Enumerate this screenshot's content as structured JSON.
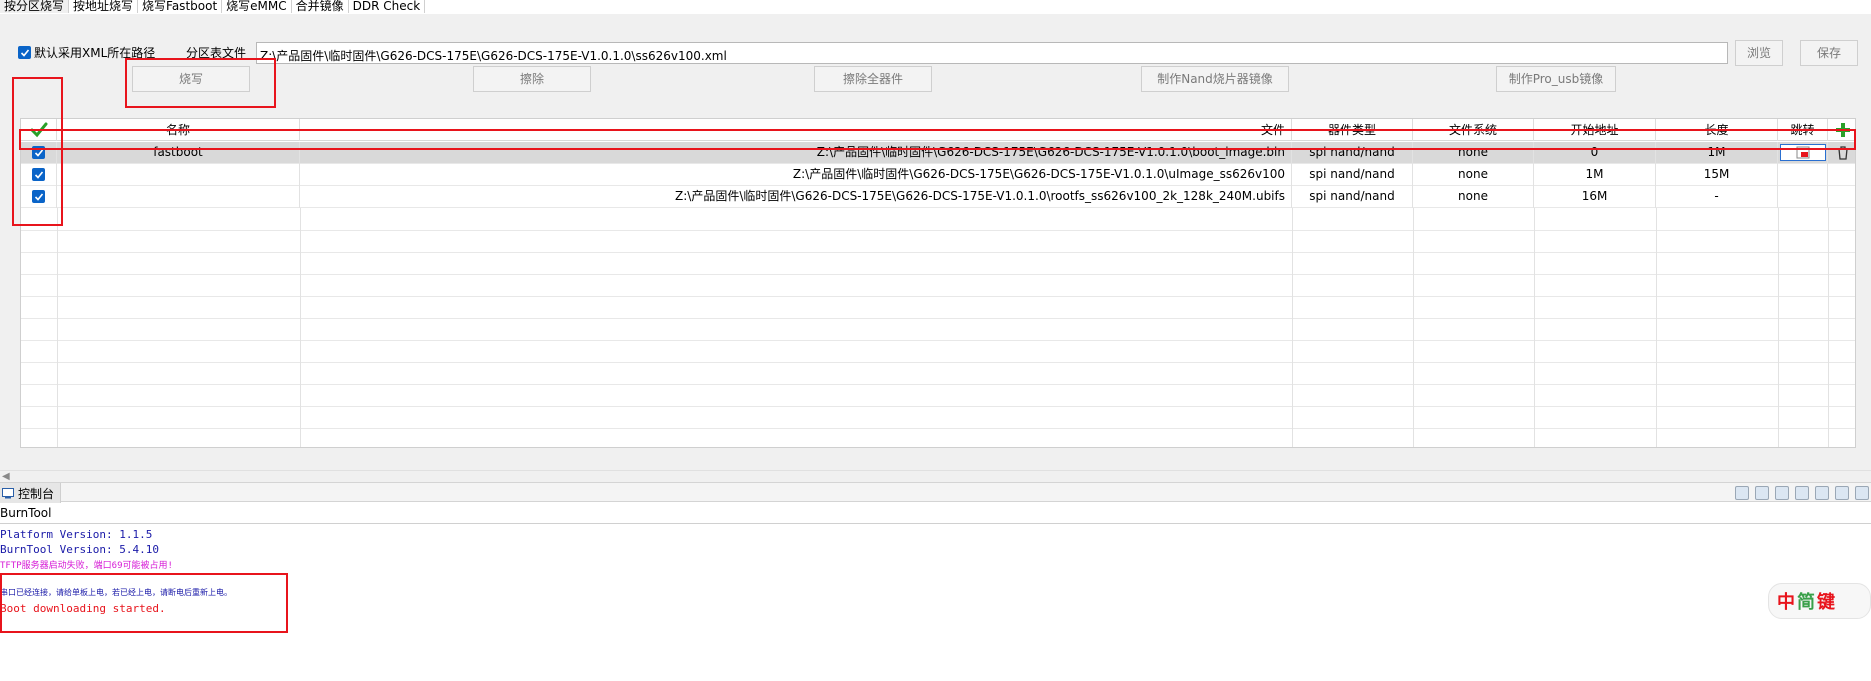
{
  "tabs": [
    "按分区烧写",
    "按地址烧写",
    "烧写Fastboot",
    "烧写eMMC",
    "合并镜像",
    "DDR Check"
  ],
  "options": {
    "use_xml_path_label": "默认采用XML所在路径",
    "partition_file_label": "分区表文件",
    "partition_file_value": "Z:\\产品固件\\临时固件\\G626-DCS-175E\\G626-DCS-175E-V1.0.1.0\\ss626v100.xml",
    "browse_label": "浏览",
    "save_label": "保存"
  },
  "actions": {
    "burn": "烧写",
    "erase": "擦除",
    "erase_all": "擦除全器件",
    "make_nand": "制作Nand烧片器镜像",
    "make_pro_usb": "制作Pro_usb镜像"
  },
  "table": {
    "headers": {
      "name": "名称",
      "file": "文件",
      "device_type": "器件类型",
      "filesystem": "文件系统",
      "start_addr": "开始地址",
      "length": "长度",
      "jump": "跳转"
    },
    "rows": [
      {
        "checked": true,
        "name": "fastboot",
        "file": "Z:\\产品固件\\临时固件\\G626-DCS-175E\\G626-DCS-175E-V1.0.1.0\\boot_image.bin",
        "device_type": "spi nand/nand",
        "filesystem": "none",
        "start_addr": "0",
        "length": "1M"
      },
      {
        "checked": true,
        "name": "",
        "file": "Z:\\产品固件\\临时固件\\G626-DCS-175E\\G626-DCS-175E-V1.0.1.0\\uImage_ss626v100",
        "device_type": "spi nand/nand",
        "filesystem": "none",
        "start_addr": "1M",
        "length": "15M"
      },
      {
        "checked": true,
        "name": "",
        "file": "Z:\\产品固件\\临时固件\\G626-DCS-175E\\G626-DCS-175E-V1.0.1.0\\rootfs_ss626v100_2k_128k_240M.ubifs",
        "device_type": "spi nand/nand",
        "filesystem": "none",
        "start_addr": "16M",
        "length": "-"
      }
    ]
  },
  "console": {
    "tab_label": "控制台",
    "name": "BurnTool",
    "lines": [
      {
        "text": "Platform Version: 1.1.5",
        "color": "#1a1aa8"
      },
      {
        "text": "BurnTool Version: 5.4.10",
        "color": "#1a1aa8"
      },
      {
        "text": "TFTP服务器启动失败，端口69可能被占用!",
        "color": "#d61ad6"
      },
      {
        "text": "串口已经连接，请给单板上电，若已经上电，请断电后重新上电。",
        "color": "#1a1aa8"
      },
      {
        "text": "Boot downloading started.",
        "color": "#e8141c"
      }
    ]
  },
  "watermark": {
    "chars": [
      "中",
      "简",
      "键"
    ]
  },
  "colors": {
    "accent": "#0a64c8",
    "highlight": "#e8141c",
    "add": "#2aa02a"
  }
}
